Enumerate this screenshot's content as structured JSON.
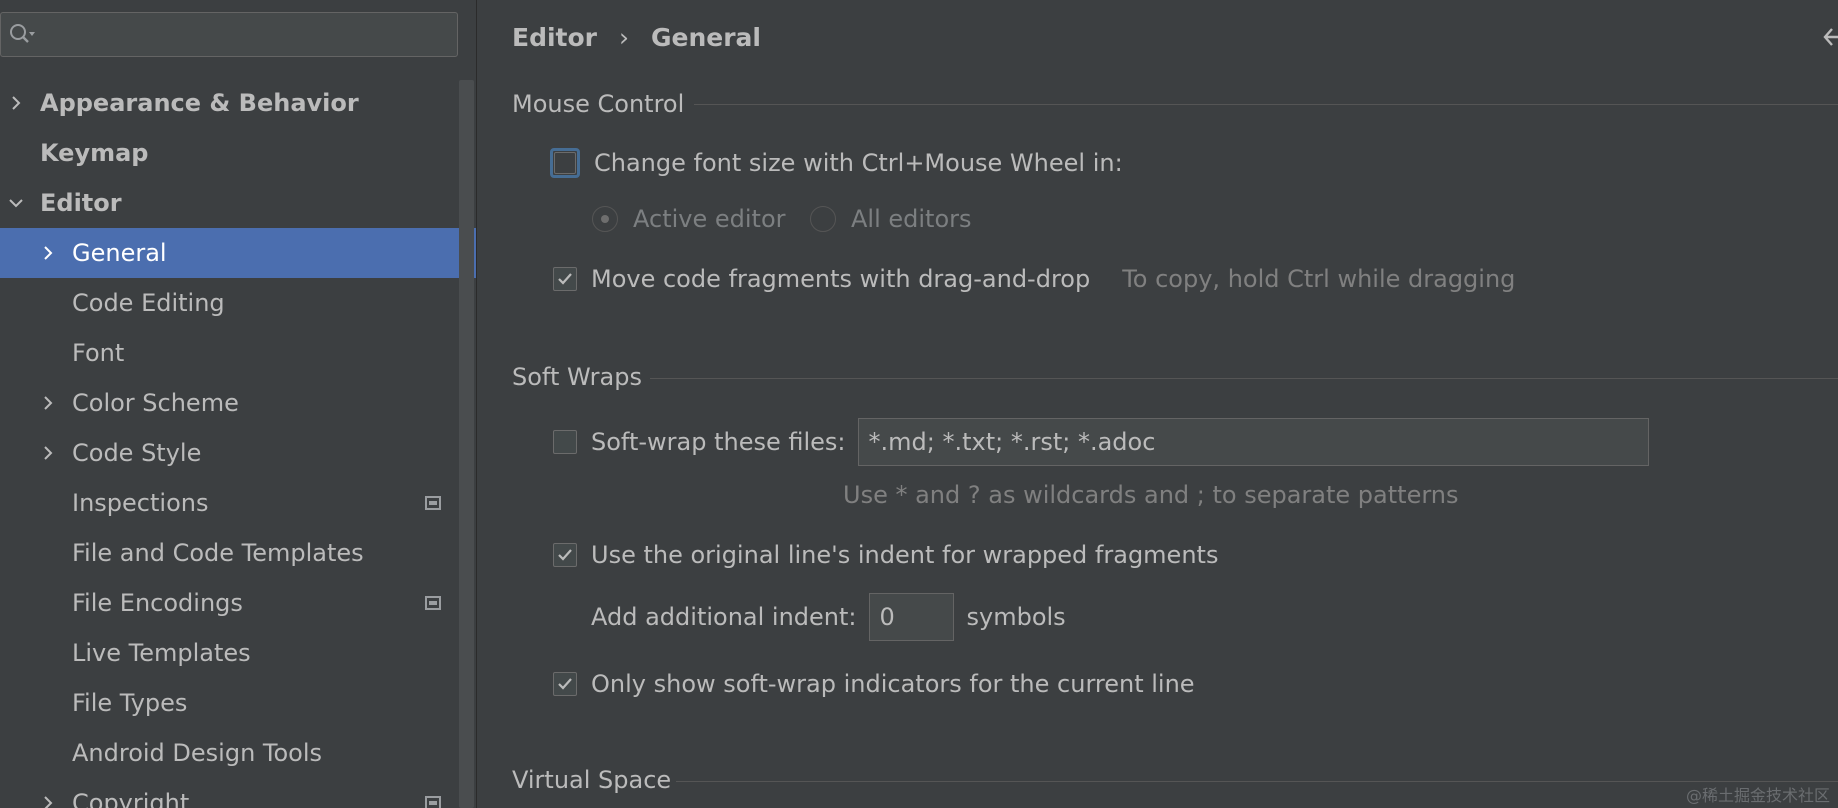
{
  "search": {
    "placeholder": "",
    "value": ""
  },
  "sidebar": {
    "items": [
      {
        "label": "Appearance & Behavior",
        "expanded": false,
        "bold": true
      },
      {
        "label": "Keymap",
        "bold": true
      },
      {
        "label": "Editor",
        "expanded": true,
        "bold": true
      },
      {
        "label": "General",
        "selected": true
      },
      {
        "label": "Code Editing"
      },
      {
        "label": "Font"
      },
      {
        "label": "Color Scheme"
      },
      {
        "label": "Code Style"
      },
      {
        "label": "Inspections",
        "badge": "project-scope-icon"
      },
      {
        "label": "File and Code Templates"
      },
      {
        "label": "File Encodings",
        "badge": "project-scope-icon"
      },
      {
        "label": "Live Templates"
      },
      {
        "label": "File Types"
      },
      {
        "label": "Android Design Tools"
      },
      {
        "label": "Copyright",
        "badge": "project-scope-icon"
      }
    ]
  },
  "breadcrumb": {
    "parent": "Editor",
    "separator": "›",
    "current": "General"
  },
  "sections": {
    "mouse_control": {
      "title": "Mouse Control",
      "change_font_size": {
        "label": "Change font size with Ctrl+Mouse Wheel in:",
        "checked": false
      },
      "active_editor": {
        "label": "Active editor",
        "selected": true,
        "enabled": false
      },
      "all_editors": {
        "label": "All editors",
        "selected": false,
        "enabled": false
      },
      "move_code": {
        "label": "Move code fragments with drag-and-drop",
        "checked": true
      },
      "move_code_hint": "To copy, hold Ctrl while dragging"
    },
    "soft_wraps": {
      "title": "Soft Wraps",
      "soft_wrap_files": {
        "label": "Soft-wrap these files:",
        "checked": false,
        "value": "*.md; *.txt; *.rst; *.adoc"
      },
      "soft_wrap_hint": "Use * and ? as wildcards and ; to separate patterns",
      "original_indent": {
        "label": "Use the original line's indent for wrapped fragments",
        "checked": true
      },
      "additional_indent": {
        "label": "Add additional indent:",
        "value": "0",
        "unit": "symbols"
      },
      "only_show_indicators": {
        "label": "Only show soft-wrap indicators for the current line",
        "checked": true
      }
    },
    "virtual_space": {
      "title": "Virtual Space"
    }
  },
  "watermark": "@稀土掘金技术社区",
  "colors": {
    "background": "#3c3f41",
    "selection": "#4b6eaf",
    "text": "#bbbbbb",
    "disabled_text": "#7c7f81",
    "focus_ring": "#466d94"
  }
}
